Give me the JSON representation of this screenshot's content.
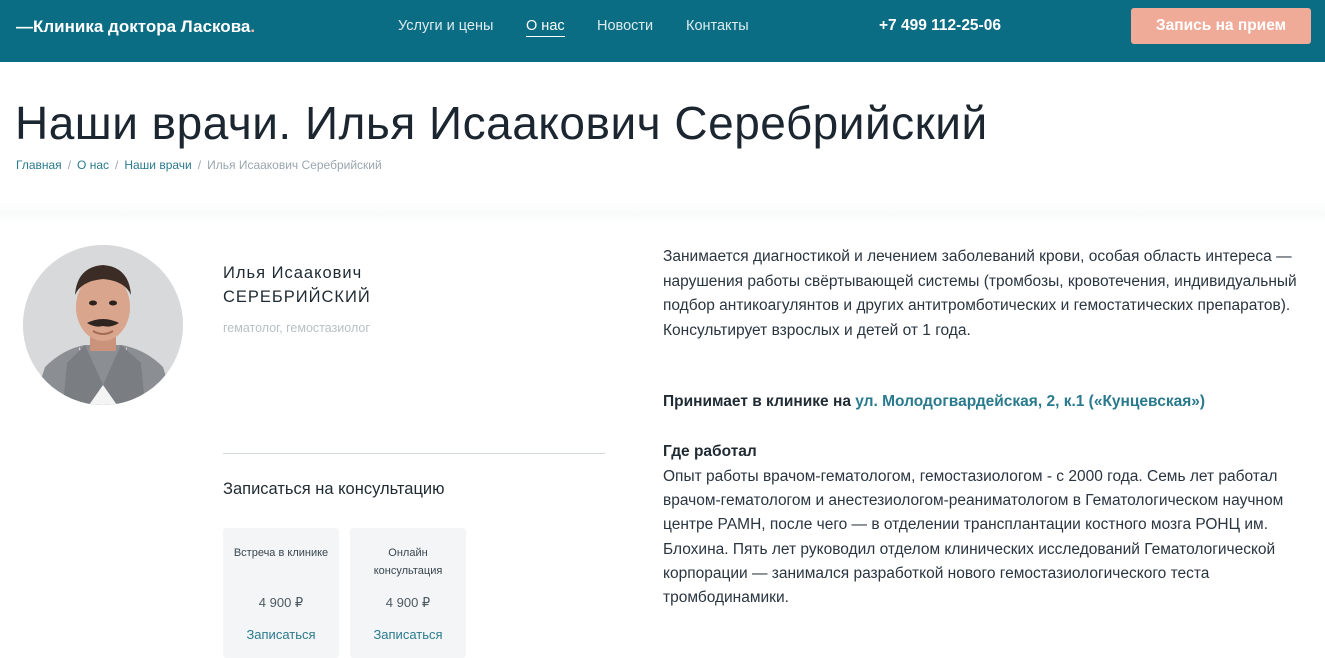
{
  "header": {
    "logo_prefix": "—Клиника доктора Ласкова",
    "logo_dot": ".",
    "nav": [
      {
        "label": "Услуги и цены"
      },
      {
        "label": "О нас"
      },
      {
        "label": "Новости"
      },
      {
        "label": "Контакты"
      }
    ],
    "phone": "+7 499 112-25-06",
    "cta_label": "Запись на прием"
  },
  "page": {
    "title": "Наши врачи. Илья Исаакович Серебрийский",
    "breadcrumbs": [
      "Главная",
      "О нас",
      "Наши врачи",
      "Илья Исаакович Серебрийский"
    ],
    "breadcrumb_separator": "/"
  },
  "doctor": {
    "first_names": "Илья Исаакович",
    "last_name": "СЕРЕБРИЙСКИЙ",
    "specialty": "гематолог, гемостазиолог"
  },
  "consult": {
    "title": "Записаться на консультацию",
    "options": [
      {
        "title": "Встреча в клинике",
        "price": "4 900 ₽",
        "button": "Записаться"
      },
      {
        "title": "Онлайн консультация",
        "price": "4 900 ₽",
        "button": "Записаться"
      }
    ]
  },
  "bio": {
    "description": "Занимается диагностикой и лечением  заболеваний крови, особая область интереса — нарушения работы свёртывающей системы (тромбозы, кровотечения, индивидуальный подбор антикоагулянтов и других антитромботических и гемостатических препаратов). Консультирует взрослых и детей от 1 года.",
    "clinic_label": "Принимает в клинике на",
    "clinic_address": "ул. Молодогвардейская, 2, к.1 («Кунцевская»)",
    "worked_title": "Где работал",
    "worked_text": "Опыт работы врачом-гематологом, гемостазиологом - с 2000 года. Семь лет работал врачом-гематологом и анестезиологом-реаниматологом в Гематологическом научном центре РАМН, после чего — в отделении трансплантации костного мозга РОНЦ им. Блохина. Пять лет руководил отделом клинических исследований Гематологической корпорации — занимался разработкой нового гемостазиологического теста тромбодинамики."
  },
  "colors": {
    "header_bg": "#0b6d83",
    "accent": "#2a7a8e",
    "cta_bg": "#f0aa98"
  }
}
